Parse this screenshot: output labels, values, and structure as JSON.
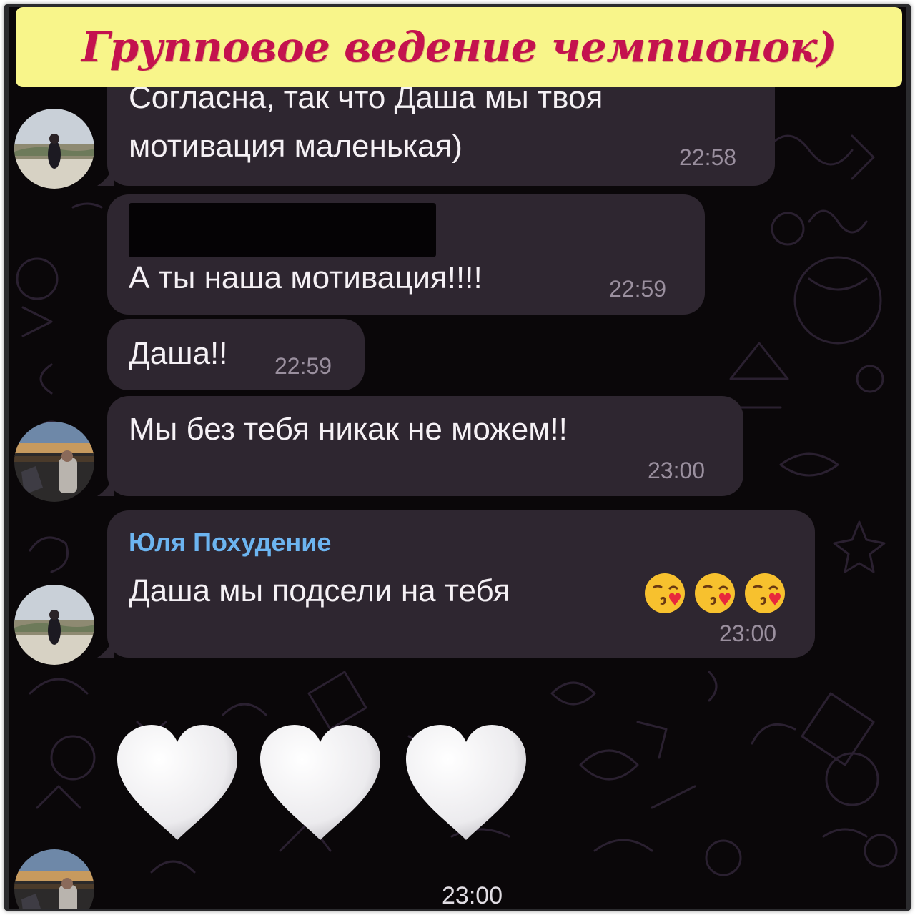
{
  "banner": {
    "title": "Групповое ведение чемпионок)"
  },
  "messages": [
    {
      "lines": [
        "Согласна, так что Даша мы твоя",
        "мотивация маленькая)"
      ],
      "time": "22:58"
    },
    {
      "text": "А ты наша мотивация!!!!",
      "time": "22:59"
    },
    {
      "text": "Даша!!",
      "time": "22:59"
    },
    {
      "text": "Мы без тебя никак не можем!!",
      "time": "23:00"
    },
    {
      "sender": "Юля Похудение",
      "text": "Даша мы подсели на тебя",
      "emojis": [
        "kissing-heart-emoji",
        "kissing-heart-emoji",
        "kissing-heart-emoji"
      ],
      "time": "23:00"
    },
    {
      "sticker": [
        "white-heart-emoji",
        "white-heart-emoji",
        "white-heart-emoji"
      ],
      "time": "23:00"
    }
  ],
  "colors": {
    "banner_background": "#f8f58a",
    "banner_text": "#c4124e",
    "chat_background": "#0a0709",
    "bubble": "#2e2630",
    "sender_name": "#6cb4f0",
    "timestamp": "#9a8f9e"
  }
}
